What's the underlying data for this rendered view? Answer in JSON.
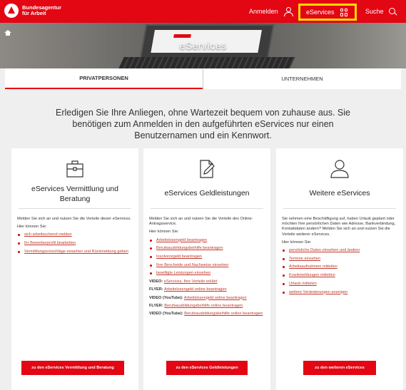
{
  "header": {
    "brand_line1": "Bundesagentur",
    "brand_line2": "für Arbeit",
    "login": "Anmelden",
    "eservices": "eServices",
    "search": "Suche"
  },
  "hero": {
    "title": "eServices"
  },
  "tabs": [
    {
      "label": "PRIVATPERSONEN",
      "active": true
    },
    {
      "label": "UNTERNEHMEN",
      "active": false
    }
  ],
  "intro": "Erledigen Sie Ihre Anliegen, ohne Wartezeit bequem von zuhause aus. Sie benötigen zum Anmelden in den aufgeführten eServices nur einen Benutzernamen und ein Kennwort.",
  "cards": [
    {
      "icon": "briefcase-icon",
      "title": "eServices Vermittlung und Beratung",
      "intro": "Melden Sie sich an und nutzen Sie die Vorteile dieser eServices.",
      "here": "Hier können Sie:",
      "links": [
        "sich arbeitsuchend melden",
        "Ihr Bewerberprofil bearbeiten",
        "Vermittlungsvorschläge einsehen und Rückmeldung geben"
      ],
      "button": "zu den eServices Vermittlung und Beratung"
    },
    {
      "icon": "document-edit-icon",
      "title": "eServices Geldleistungen",
      "intro": "Melden Sie sich an und nutzen Sie die Vorteile des Online-Antragsservice.",
      "here": "Hier können Sie:",
      "links": [
        "Arbeitslosengeld beantragen",
        "Berufsausbildungsbeihilfe beantragen",
        "Insolvenzgeld beantragen",
        "Ihre Bescheide und Nachweise einsehen",
        "bewilligte Leistungen einsehen"
      ],
      "media": [
        {
          "label": "VIDEO:",
          "link": "eServices, Ihre Vorteile erklärt"
        },
        {
          "label": "FLYER:",
          "link": "Arbeitslosengeld online beantragen"
        },
        {
          "label": "VIDEO (YouTube):",
          "link": "Arbeitslosengeld online beantragen"
        },
        {
          "label": "FLYER:",
          "link": "Berufsausbildungsbeihilfe online beantragen"
        },
        {
          "label": "VIDEO (YouTube):",
          "link": "Berufsausbildungsbeihilfe online beantragen"
        }
      ],
      "button": "zu den eServices Geldleistungen"
    },
    {
      "icon": "person-icon",
      "title": "Weitere eServices",
      "intro": "Sie nehmen eine Beschäftigung auf, haben Urlaub geplant oder möchten Ihre persönlichen Daten wie Adresse, Bankverbindung, Kontaktdaten ändern? Melden Sie sich an und nutzen Sie die Vorteile weiterer eServices.",
      "here": "Hier können Sie:",
      "links": [
        "persönliche Daten einsehen und ändern",
        "Termine einsehen",
        "Arbeitsaufnahmen mitteilen",
        "Krankmeldungen mitteilen",
        "Urlaub mitteilen",
        "weitere Veränderungen anzeigen"
      ],
      "button": "zu den weiteren eServices"
    }
  ],
  "colors": {
    "brand_red": "#e30613",
    "highlight": "#ffd800",
    "link": "#c0392b"
  }
}
